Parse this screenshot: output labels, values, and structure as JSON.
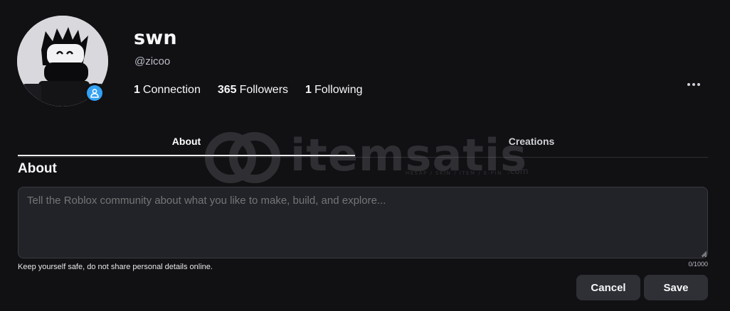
{
  "profile": {
    "display_name": "swn",
    "username": "@zicoo",
    "avatar_icon": "avatar-image",
    "presence_icon": "online-person-icon",
    "presence_color": "#33a2f5"
  },
  "stats": [
    {
      "count": "1",
      "label": "Connection"
    },
    {
      "count": "365",
      "label": "Followers"
    },
    {
      "count": "1",
      "label": "Following"
    }
  ],
  "more_icon": "more-horizontal-icon",
  "tabs": [
    {
      "label": "About",
      "active": true
    },
    {
      "label": "Creations",
      "active": false
    }
  ],
  "watermark": {
    "text": "itemsatis",
    "sub": "HESAP / SKIN / ITEM / E-PIN",
    "suffix": ".com"
  },
  "about": {
    "title": "About",
    "placeholder": "Tell the Roblox community about what you like to make, build, and explore...",
    "value": "",
    "safety_note": "Keep yourself safe, do not share personal details online.",
    "char_count": "0/1000"
  },
  "actions": {
    "cancel_label": "Cancel",
    "save_label": "Save"
  }
}
